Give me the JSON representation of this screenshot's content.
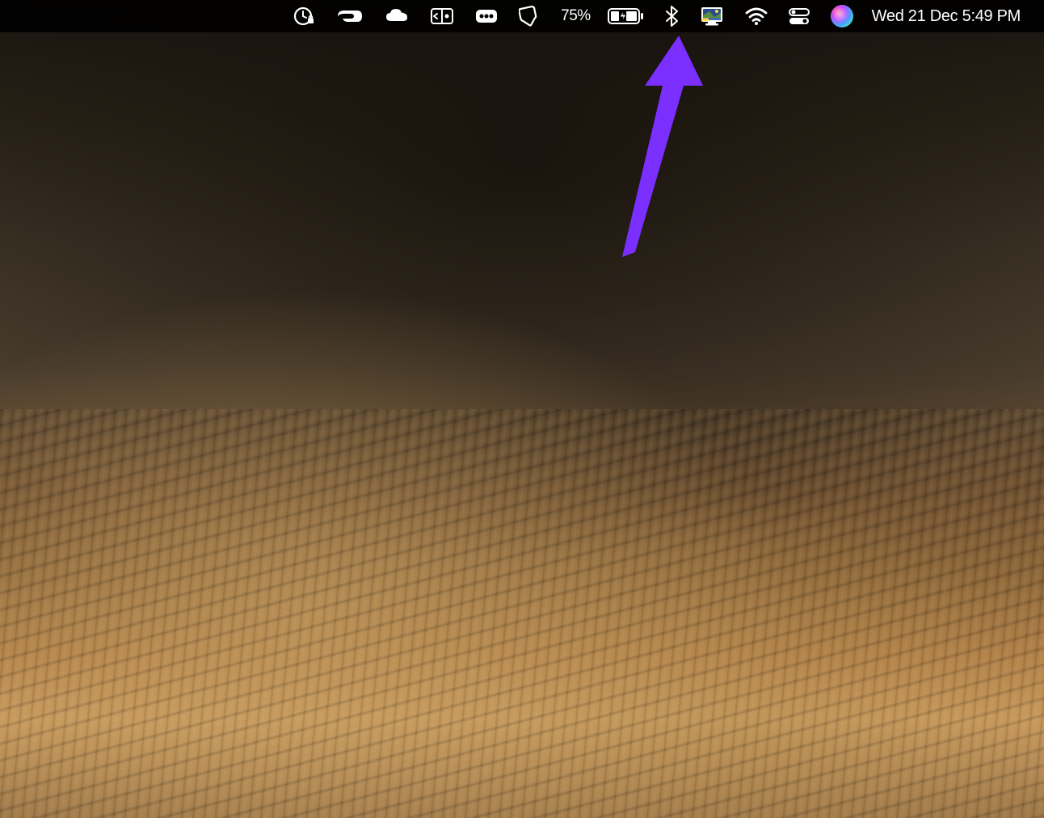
{
  "menubar": {
    "battery_percent": "75%",
    "datetime": "Wed 21 Dec  5:49 PM",
    "icons": {
      "app1": "clock-lock-icon",
      "app2": "expressvpn-icon",
      "app3": "cloud-icon",
      "app4": "screen-mirror-icon",
      "app5": "dots-icon",
      "app6": "tag-icon",
      "battery": "battery-charging-icon",
      "bluetooth": "bluetooth-icon",
      "display": "display-color-icon",
      "wifi": "wifi-icon",
      "control_center": "control-center-icon",
      "siri": "siri-icon"
    }
  },
  "annotation": {
    "arrow_color": "#7B2FFF",
    "target": "control-center-icon"
  }
}
